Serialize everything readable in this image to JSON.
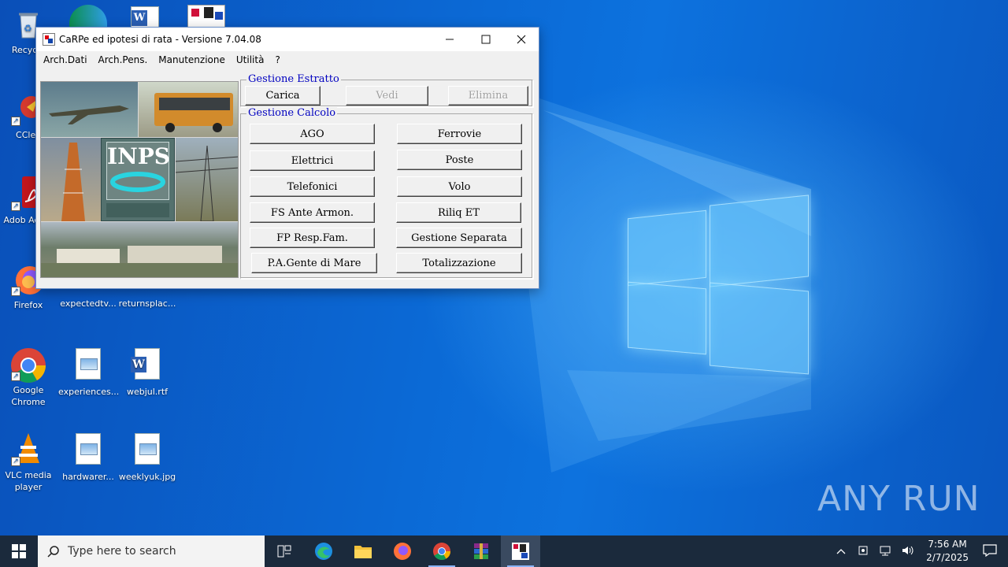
{
  "desktop": {
    "icons": [
      {
        "label": "Recycle"
      },
      {
        "label": "CClea"
      },
      {
        "label": "Adob Acrob"
      },
      {
        "label": "Firefox"
      },
      {
        "label": "expectedtv..."
      },
      {
        "label": "returnsplac..."
      },
      {
        "label": "Google Chrome"
      },
      {
        "label": "experiences..."
      },
      {
        "label": "webjul.rtf"
      },
      {
        "label": "VLC media player"
      },
      {
        "label": "hardwarer..."
      },
      {
        "label": "weeklyuk.jpg"
      }
    ],
    "watermark": "ANY RUN"
  },
  "window": {
    "title": "CaRPe ed ipotesi di rata  -  Versione 7.04.08",
    "menu": [
      "Arch.Dati",
      "Arch.Pens.",
      "Manutenzione",
      "Utilità",
      "?"
    ],
    "photo_logo_text": "INPS",
    "estratto": {
      "legend": "Gestione Estratto",
      "buttons": [
        {
          "label": "Carica",
          "enabled": true
        },
        {
          "label": "Vedi",
          "enabled": false
        },
        {
          "label": "Elimina",
          "enabled": false
        }
      ]
    },
    "calcolo": {
      "legend": "Gestione Calcolo",
      "buttons": [
        {
          "label": "AGO"
        },
        {
          "label": "Ferrovie"
        },
        {
          "label": "Elettrici"
        },
        {
          "label": "Poste"
        },
        {
          "label": "Telefonici"
        },
        {
          "label": "Volo"
        },
        {
          "label": "FS Ante Armon."
        },
        {
          "label": "Riliq ET"
        },
        {
          "label": "FP Resp.Fam."
        },
        {
          "label": "Gestione Separata"
        },
        {
          "label": "P.A.Gente di Mare"
        },
        {
          "label": "Totalizzazione"
        }
      ]
    }
  },
  "taskbar": {
    "search_placeholder": "Type here to search",
    "time": "7:56 AM",
    "date": "2/7/2025"
  }
}
